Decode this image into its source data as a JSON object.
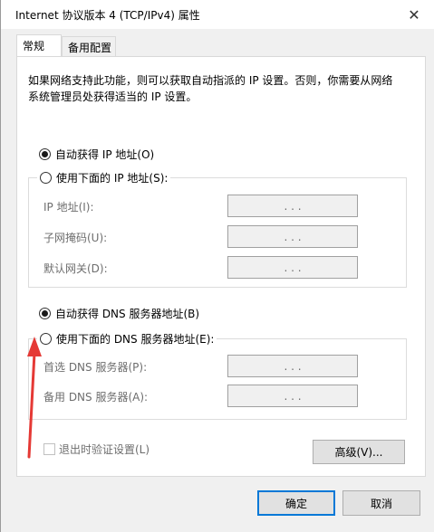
{
  "window": {
    "title": "Internet 协议版本 4 (TCP/IPv4) 属性",
    "close_label": "✕"
  },
  "tabs": [
    {
      "label": "常规",
      "active": true
    },
    {
      "label": "备用配置",
      "active": false
    }
  ],
  "description": "如果网络支持此功能，则可以获取自动指派的 IP 设置。否则，你需要从网络系统管理员处获得适当的 IP 设置。",
  "ip_section": {
    "auto_label": "自动获得 IP 地址(O)",
    "auto_selected": true,
    "manual_label": "使用下面的 IP 地址(S):",
    "manual_selected": false,
    "fields": [
      {
        "label": "IP 地址(I):",
        "value": ". . ."
      },
      {
        "label": "子网掩码(U):",
        "value": ". . ."
      },
      {
        "label": "默认网关(D):",
        "value": ". . ."
      }
    ]
  },
  "dns_section": {
    "auto_label": "自动获得 DNS 服务器地址(B)",
    "auto_selected": true,
    "manual_label": "使用下面的 DNS 服务器地址(E):",
    "manual_selected": false,
    "fields": [
      {
        "label": "首选 DNS 服务器(P):",
        "value": ". . ."
      },
      {
        "label": "备用 DNS 服务器(A):",
        "value": ". . ."
      }
    ]
  },
  "validate_label": "退出时验证设置(L)",
  "validate_checked": false,
  "advanced_label": "高级(V)...",
  "ok_label": "确定",
  "cancel_label": "取消",
  "colors": {
    "accent": "#0078d7",
    "arrow": "#e53935"
  }
}
